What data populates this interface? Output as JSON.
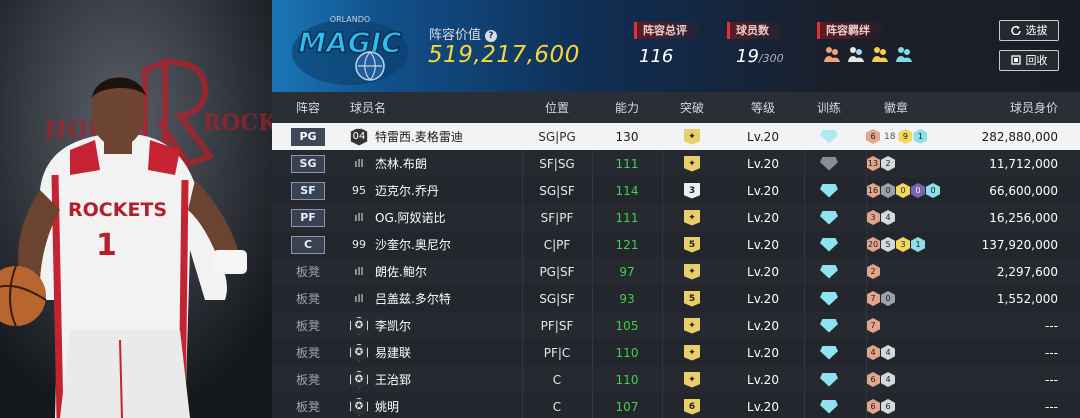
{
  "team": {
    "logo_text": "MAGIC",
    "logo_sub": "ORLANDO"
  },
  "player_art": {
    "team_word": "HOUSTON ROCKETS",
    "jersey": "ROCKETS"
  },
  "header": {
    "value_label": "阵容价值",
    "value": "519,217,600",
    "total_rating_label": "阵容总评",
    "total_rating": "116",
    "count_label": "球员数",
    "count": "19",
    "count_max": "/300",
    "chem_label": "阵容羁绊",
    "chem_icons": [
      "bond-icon-1",
      "bond-icon-2",
      "bond-icon-3",
      "bond-icon-4"
    ],
    "btn_pick": "选拔",
    "btn_recycle": "回收"
  },
  "columns": {
    "slot": "阵容",
    "name": "球员名",
    "pos": "位置",
    "ovr": "能力",
    "brk": "突破",
    "lv": "等级",
    "train": "训练",
    "badge": "徽章",
    "val": "球员身价"
  },
  "colors": {
    "accent_gold": "#f6d63a",
    "green": "#41d04d",
    "tag_red": "#e03232"
  },
  "rows": [
    {
      "slot": "PG",
      "slot_type": "tag",
      "num": "04",
      "num_type": "hex",
      "name": "特雷西.麦格雷迪",
      "pos": "SG|PG",
      "ovr": "130",
      "brk": "✦",
      "brk_type": "lo",
      "lv": "Lv.20",
      "train": "cyan",
      "badges": [
        [
          "b-bronze",
          "6"
        ],
        [
          "b-plain",
          "18"
        ],
        [
          "b-gold",
          "9"
        ],
        [
          "b-blue",
          "1"
        ]
      ],
      "val": "282,880,000",
      "selected": true
    },
    {
      "slot": "SG",
      "slot_type": "tag",
      "num": "ıll",
      "num_type": "plain",
      "name": "杰林.布朗",
      "pos": "SF|SG",
      "ovr": "111",
      "brk": "✦",
      "brk_type": "lo",
      "lv": "Lv.20",
      "train": "gray",
      "badges": [
        [
          "b-bronze",
          "13"
        ],
        [
          "b-silver",
          "2"
        ]
      ],
      "val": "11,712,000"
    },
    {
      "slot": "SF",
      "slot_type": "tag",
      "num": "95",
      "num_type": "plain",
      "name": "迈克尔.乔丹",
      "pos": "SG|SF",
      "ovr": "114",
      "brk": "3",
      "brk_type": "white",
      "lv": "Lv.20",
      "train": "cyan",
      "badges": [
        [
          "b-bronze",
          "16"
        ],
        [
          "b-grey",
          "0"
        ],
        [
          "b-gold",
          "0"
        ],
        [
          "b-purple",
          "0"
        ],
        [
          "b-blue",
          "0"
        ]
      ],
      "val": "66,600,000"
    },
    {
      "slot": "PF",
      "slot_type": "tag",
      "num": "ıll",
      "num_type": "plain",
      "name": "OG.阿奴诺比",
      "pos": "SF|PF",
      "ovr": "111",
      "brk": "✦",
      "brk_type": "lo",
      "lv": "Lv.20",
      "train": "cyan",
      "badges": [
        [
          "b-bronze",
          "3"
        ],
        [
          "b-silver",
          "4"
        ]
      ],
      "val": "16,256,000"
    },
    {
      "slot": "C",
      "slot_type": "tag",
      "num": "99",
      "num_type": "plain",
      "name": "沙奎尔.奥尼尔",
      "pos": "C|PF",
      "ovr": "121",
      "brk": "5",
      "brk_type": "lo",
      "lv": "Lv.20",
      "train": "cyan",
      "badges": [
        [
          "b-bronze",
          "20"
        ],
        [
          "b-silver",
          "5"
        ],
        [
          "b-gold",
          "3"
        ],
        [
          "b-blue",
          "1"
        ]
      ],
      "val": "137,920,000"
    },
    {
      "slot": "板凳",
      "slot_type": "text",
      "num": "ıll",
      "num_type": "plain",
      "name": "朗佐.鲍尔",
      "pos": "PG|SF",
      "ovr": "97",
      "brk": "✦",
      "brk_type": "lo",
      "lv": "Lv.20",
      "train": "cyan",
      "badges": [
        [
          "b-bronze",
          "2"
        ]
      ],
      "val": "2,297,600"
    },
    {
      "slot": "板凳",
      "slot_type": "text",
      "num": "ıll",
      "num_type": "plain",
      "name": "吕盖兹.多尔特",
      "pos": "SG|SF",
      "ovr": "93",
      "brk": "5",
      "brk_type": "lo",
      "lv": "Lv.20",
      "train": "cyan",
      "badges": [
        [
          "b-bronze",
          "7"
        ],
        [
          "b-grey",
          "0"
        ]
      ],
      "val": "1,552,000"
    },
    {
      "slot": "板凳",
      "slot_type": "text",
      "num": "✪",
      "num_type": "hex",
      "name": "李凯尔",
      "pos": "PF|SF",
      "ovr": "105",
      "brk": "✦",
      "brk_type": "lo",
      "lv": "Lv.20",
      "train": "cyan",
      "badges": [
        [
          "b-bronze",
          "7"
        ]
      ],
      "val": "---"
    },
    {
      "slot": "板凳",
      "slot_type": "text",
      "num": "✪",
      "num_type": "hex",
      "name": "易建联",
      "pos": "PF|C",
      "ovr": "110",
      "brk": "✦",
      "brk_type": "lo",
      "lv": "Lv.20",
      "train": "cyan",
      "badges": [
        [
          "b-bronze",
          "4"
        ],
        [
          "b-silver",
          "4"
        ]
      ],
      "val": "---"
    },
    {
      "slot": "板凳",
      "slot_type": "text",
      "num": "✪",
      "num_type": "hex",
      "name": "王治郅",
      "pos": "C",
      "ovr": "110",
      "brk": "✦",
      "brk_type": "lo",
      "lv": "Lv.20",
      "train": "cyan",
      "badges": [
        [
          "b-bronze",
          "6"
        ],
        [
          "b-silver",
          "4"
        ]
      ],
      "val": "---"
    },
    {
      "slot": "板凳",
      "slot_type": "text",
      "num": "✪",
      "num_type": "hex",
      "name": "姚明",
      "pos": "C",
      "ovr": "107",
      "brk": "6",
      "brk_type": "lo",
      "lv": "Lv.20",
      "train": "cyan",
      "badges": [
        [
          "b-bronze",
          "6"
        ],
        [
          "b-silver",
          "6"
        ]
      ],
      "val": "---"
    }
  ]
}
